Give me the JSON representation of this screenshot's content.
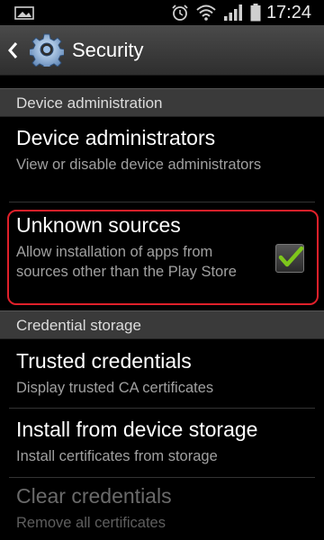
{
  "status_bar": {
    "time": "17:24",
    "icons": [
      "image-icon",
      "alarm-icon",
      "wifi-icon",
      "signal-icon",
      "battery-icon"
    ]
  },
  "action_bar": {
    "title": "Security",
    "icons": [
      "back-icon",
      "gear-icon"
    ]
  },
  "sections": [
    {
      "header": "Device administration",
      "items": [
        {
          "title": "Device administrators",
          "summary": "View or disable device administrators"
        },
        {
          "title": "Unknown sources",
          "summary": "Allow installation of apps from sources other than the Play Store",
          "checked": true
        }
      ]
    },
    {
      "header": "Credential storage",
      "items": [
        {
          "title": "Trusted credentials",
          "summary": "Display trusted CA certificates"
        },
        {
          "title": "Install from device storage",
          "summary": "Install certificates from storage"
        },
        {
          "title": "Clear credentials",
          "summary": "Remove all certificates",
          "disabled": true
        }
      ]
    }
  ],
  "colors": {
    "highlight": "#e0202a",
    "check": "#7ec61c",
    "section_bg": "#3a3a3a"
  }
}
